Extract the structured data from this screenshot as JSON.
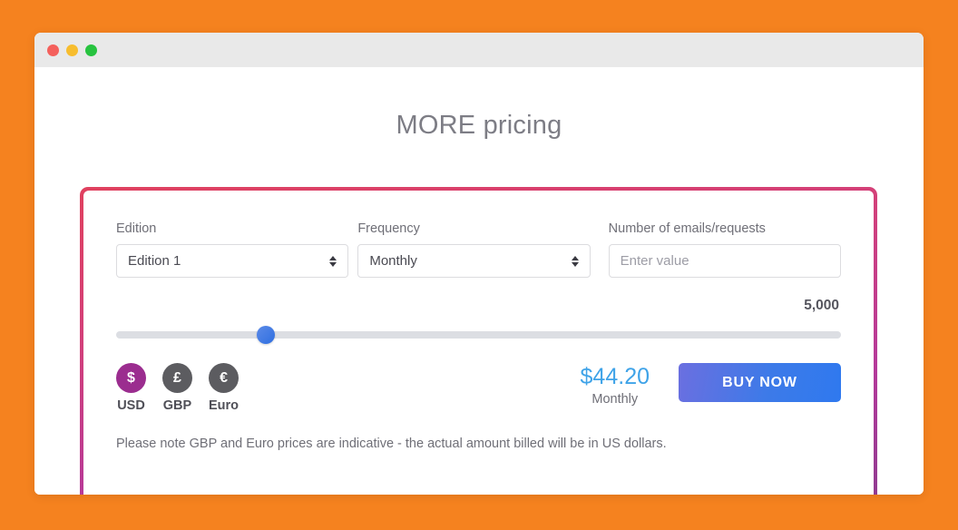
{
  "window": {
    "traffic_lights": [
      {
        "name": "close",
        "color": "#f4605c"
      },
      {
        "name": "minimize",
        "color": "#f7bd2e"
      },
      {
        "name": "maximize",
        "color": "#27c33f"
      }
    ]
  },
  "page": {
    "title": "MORE pricing",
    "background_color": "#f5821f",
    "panel_border_gradient": [
      "#e0415f",
      "#8e3a90"
    ]
  },
  "form": {
    "edition": {
      "label": "Edition",
      "value": "Edition 1"
    },
    "frequency": {
      "label": "Frequency",
      "value": "Monthly"
    },
    "number": {
      "label": "Number of emails/requests",
      "value": "",
      "placeholder": "Enter value"
    }
  },
  "slider": {
    "display_value": "5,000",
    "handle_percent": 20.6,
    "track_color": "#dcdee3",
    "handle_color": "#2f6fe0"
  },
  "currencies": [
    {
      "code": "USD",
      "symbol": "$",
      "active": true,
      "color": "#9b2d8f"
    },
    {
      "code": "GBP",
      "symbol": "£",
      "active": false,
      "color": "#5c5c60"
    },
    {
      "code": "Euro",
      "symbol": "€",
      "active": false,
      "color": "#5c5c60"
    }
  ],
  "price": {
    "amount": "$44.20",
    "period": "Monthly",
    "color": "#3fa3e8"
  },
  "cta": {
    "label": "BUY NOW"
  },
  "note": {
    "text": "Please note GBP and Euro prices are indicative - the actual amount billed will be in US dollars."
  }
}
